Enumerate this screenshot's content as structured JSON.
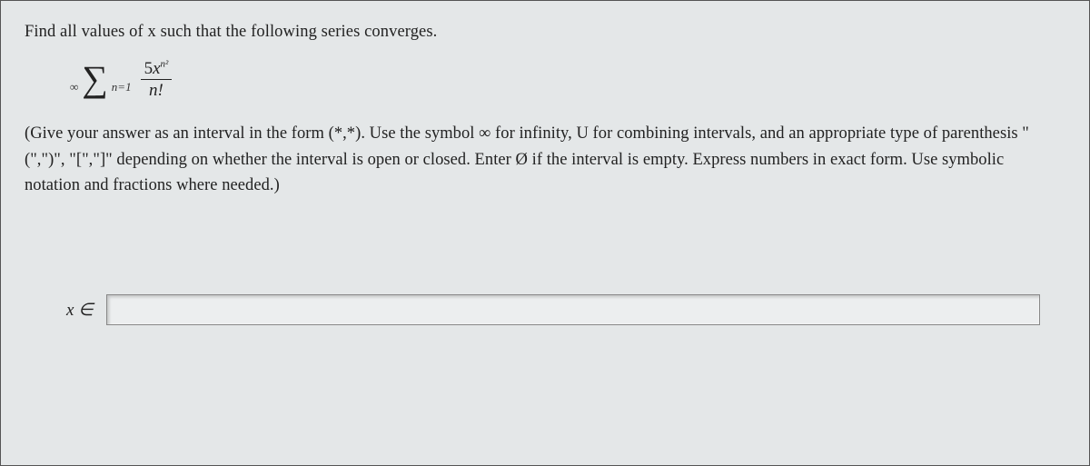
{
  "question": {
    "prompt": "Find all values of x such that the following series converges."
  },
  "formula": {
    "sum_upper": "∞",
    "sum_lower": "n=1",
    "numerator_coeff": "5",
    "numerator_var": "x",
    "numerator_exp": "n²",
    "denominator": "n!"
  },
  "instructions": {
    "text": "(Give your answer as an interval in the form (*,*). Use the symbol ∞ for infinity, U for combining intervals, and an appropriate type of parenthesis \"(\",\")\", \"[\",\"]\" depending on whether the interval is open or closed. Enter Ø if the interval is empty. Express numbers in exact form. Use symbolic notation and fractions where needed.)"
  },
  "answer": {
    "label": "x ∈",
    "value": ""
  }
}
